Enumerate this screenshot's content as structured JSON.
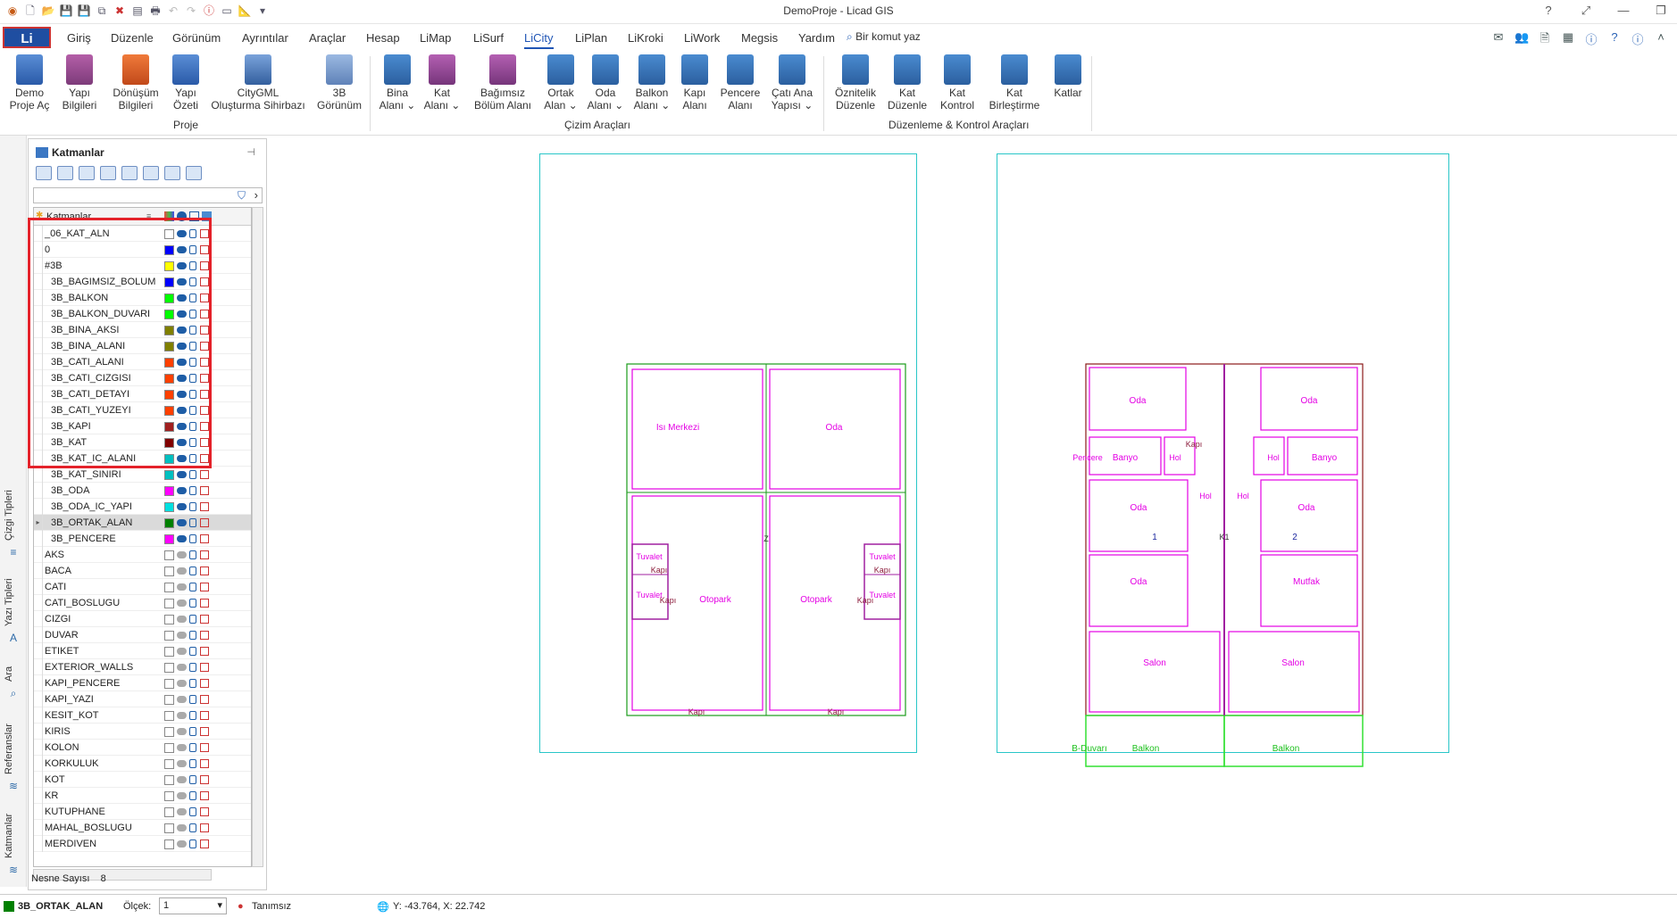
{
  "app": {
    "title": "DemoProje - Licad GIS"
  },
  "menubar": {
    "logo": "Li",
    "items": [
      "Giriş",
      "Düzenle",
      "Görünüm",
      "Ayrıntılar",
      "Araçlar",
      "Hesap",
      "LiMap",
      "LiSurf",
      "LiCity",
      "LiPlan",
      "LiKroki",
      "LiWork",
      "Megsis",
      "Yardım"
    ],
    "active": "LiCity",
    "command_placeholder": "Bir komut yaz"
  },
  "ribbon": {
    "buttons": [
      {
        "label": "Demo\nProje Aç",
        "icon": "building-icon"
      },
      {
        "label": "Yapı\nBilgileri",
        "icon": "form-icon"
      },
      {
        "label": "Dönüşüm\nBilgileri",
        "icon": "transform-icon"
      },
      {
        "label": "Yapı\nÖzeti",
        "icon": "summary-icon"
      },
      {
        "label": "CityGML\nOluşturma Sihirbazı",
        "icon": "citygml-icon"
      },
      {
        "label": "3B\nGörünüm",
        "icon": "3d-view-icon"
      },
      {
        "label": "Bina\nAlanı ⌄",
        "icon": "building-area-icon"
      },
      {
        "label": "Kat\nAlanı ⌄",
        "icon": "floor-area-icon"
      },
      {
        "label": "Bağımsız\nBölüm Alanı",
        "icon": "unit-area-icon"
      },
      {
        "label": "Ortak\nAlan ⌄",
        "icon": "common-area-icon"
      },
      {
        "label": "Oda\nAlanı ⌄",
        "icon": "room-area-icon"
      },
      {
        "label": "Balkon\nAlanı ⌄",
        "icon": "balcony-area-icon"
      },
      {
        "label": "Kapı\nAlanı",
        "icon": "door-area-icon"
      },
      {
        "label": "Pencere\nAlanı",
        "icon": "window-area-icon"
      },
      {
        "label": "Çatı Ana\nYapısı ⌄",
        "icon": "roof-icon"
      },
      {
        "label": "Öznitelik\nDüzenle",
        "icon": "attribute-edit-icon"
      },
      {
        "label": "Kat\nDüzenle",
        "icon": "floor-edit-icon"
      },
      {
        "label": "Kat\nKontrol",
        "icon": "floor-check-icon"
      },
      {
        "label": "Kat\nBirleştirme",
        "icon": "floor-merge-icon"
      },
      {
        "label": "Katlar",
        "icon": "floors-icon"
      }
    ],
    "groups": [
      "Proje",
      "Çizim Araçları",
      "Düzenleme & Kontrol Araçları"
    ]
  },
  "sidetabs": [
    "Çizgi Tipleri",
    "Yazı Tipleri",
    "Ara",
    "Referanslar",
    "Katmanlar"
  ],
  "layers_panel": {
    "title": "Katmanlar",
    "column_name": "Katmanlar",
    "rows": [
      {
        "name": "_06_KAT_ALN",
        "color": "#ffffff",
        "on": true,
        "indent": false
      },
      {
        "name": "0",
        "color": "#0000ff",
        "on": true,
        "indent": false
      },
      {
        "name": "#3B",
        "color": "#ffff00",
        "on": true,
        "indent": false
      },
      {
        "name": "3B_BAGIMSIZ_BOLUM",
        "color": "#0000ff",
        "on": true,
        "indent": true
      },
      {
        "name": "3B_BALKON",
        "color": "#00ff00",
        "on": true,
        "indent": true
      },
      {
        "name": "3B_BALKON_DUVARI",
        "color": "#00ff00",
        "on": true,
        "indent": true
      },
      {
        "name": "3B_BINA_AKSI",
        "color": "#808000",
        "on": true,
        "indent": true
      },
      {
        "name": "3B_BINA_ALANI",
        "color": "#808000",
        "on": true,
        "indent": true
      },
      {
        "name": "3B_CATI_ALANI",
        "color": "#ff4000",
        "on": true,
        "indent": true
      },
      {
        "name": "3B_CATI_CIZGISI",
        "color": "#ff4000",
        "on": true,
        "indent": true
      },
      {
        "name": "3B_CATI_DETAYI",
        "color": "#ff4000",
        "on": true,
        "indent": true
      },
      {
        "name": "3B_CATI_YUZEYI",
        "color": "#ff4000",
        "on": true,
        "indent": true
      },
      {
        "name": "3B_KAPI",
        "color": "#a02020",
        "on": true,
        "indent": true
      },
      {
        "name": "3B_KAT",
        "color": "#800000",
        "on": true,
        "indent": true
      },
      {
        "name": "3B_KAT_IC_ALANI",
        "color": "#00c0c0",
        "on": true,
        "indent": true
      },
      {
        "name": "3B_KAT_SINIRI",
        "color": "#00c0c0",
        "on": true,
        "indent": true
      },
      {
        "name": "3B_ODA",
        "color": "#ff00ff",
        "on": true,
        "indent": true
      },
      {
        "name": "3B_ODA_IC_YAPI",
        "color": "#00e0e0",
        "on": true,
        "indent": true
      },
      {
        "name": "3B_ORTAK_ALAN",
        "color": "#008000",
        "on": true,
        "indent": true,
        "selected": true
      },
      {
        "name": "3B_PENCERE",
        "color": "#ff00ff",
        "on": true,
        "indent": true
      },
      {
        "name": "AKS",
        "color": "#ffffff",
        "on": false,
        "indent": false
      },
      {
        "name": "BACA",
        "color": "#ffffff",
        "on": false,
        "indent": false
      },
      {
        "name": "CATI",
        "color": "#ffffff",
        "on": false,
        "indent": false
      },
      {
        "name": "CATI_BOSLUGU",
        "color": "#ffffff",
        "on": false,
        "indent": false
      },
      {
        "name": "CIZGI",
        "color": "#ffffff",
        "on": false,
        "indent": false
      },
      {
        "name": "DUVAR",
        "color": "#ffffff",
        "on": false,
        "indent": false
      },
      {
        "name": "ETIKET",
        "color": "#ffffff",
        "on": false,
        "indent": false
      },
      {
        "name": "EXTERIOR_WALLS",
        "color": "#ffffff",
        "on": false,
        "indent": false
      },
      {
        "name": "KAPI_PENCERE",
        "color": "#ffffff",
        "on": false,
        "indent": false
      },
      {
        "name": "KAPI_YAZI",
        "color": "#ffffff",
        "on": false,
        "indent": false
      },
      {
        "name": "KESIT_KOT",
        "color": "#ffffff",
        "on": false,
        "indent": false
      },
      {
        "name": "KIRIS",
        "color": "#ffffff",
        "on": false,
        "indent": false
      },
      {
        "name": "KOLON",
        "color": "#ffffff",
        "on": false,
        "indent": false
      },
      {
        "name": "KORKULUK",
        "color": "#ffffff",
        "on": false,
        "indent": false
      },
      {
        "name": "KOT",
        "color": "#ffffff",
        "on": false,
        "indent": false
      },
      {
        "name": "KR",
        "color": "#ffffff",
        "on": false,
        "indent": false
      },
      {
        "name": "KUTUPHANE",
        "color": "#ffffff",
        "on": false,
        "indent": false
      },
      {
        "name": "MAHAL_BOSLUGU",
        "color": "#ffffff",
        "on": false,
        "indent": false
      },
      {
        "name": "MERDIVEN",
        "color": "#ffffff",
        "on": false,
        "indent": false
      }
    ],
    "footer_label": "Nesne Sayısı",
    "footer_value": "8"
  },
  "statusbar": {
    "layer": "3B_ORTAK_ALAN",
    "scale_label": "Ölçek:",
    "scale_value": "1",
    "style": "Tanımsız",
    "coords": "Y: -43.764, X: 22.742"
  },
  "drawing": {
    "left_labels": [
      "Isı Merkezi",
      "Oda",
      "Otopark",
      "Otopark",
      "Tuvalet",
      "Tuvalet",
      "Tuvalet",
      "Tuvalet",
      "Kapı",
      "Kapı",
      "Kapı",
      "Kapı",
      "Kapı",
      "Kapı",
      "Z"
    ],
    "right_labels": [
      "Oda",
      "Oda",
      "Oda",
      "Oda",
      "Oda",
      "Mutfak",
      "Salon",
      "Salon",
      "Banyo",
      "Banyo",
      "Hol",
      "Hol",
      "Hol",
      "Hol",
      "Pencere",
      "Kapı",
      "Balkon",
      "Balkon",
      "B-Duvarı",
      "1",
      "2",
      "K1"
    ]
  }
}
